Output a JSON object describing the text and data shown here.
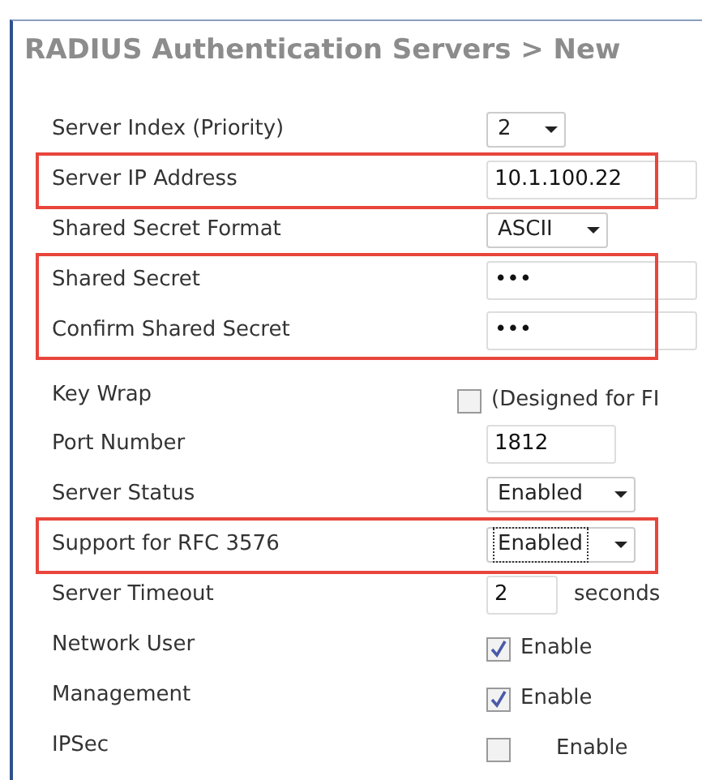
{
  "title": "RADIUS Authentication Servers > New",
  "sections": [
    {
      "highlighted": false,
      "rows": [
        {
          "label": "Server Index (Priority)",
          "kind": "select",
          "value": "2",
          "focused": false
        }
      ]
    },
    {
      "highlighted": true,
      "rows": [
        {
          "label": "Server IP Address",
          "kind": "text",
          "value": "10.1.100.22"
        }
      ]
    },
    {
      "highlighted": false,
      "rows": [
        {
          "label": "Shared Secret Format",
          "kind": "select",
          "value": "ASCII",
          "focused": false
        }
      ]
    },
    {
      "highlighted": true,
      "rows": [
        {
          "label": "Shared Secret",
          "kind": "text",
          "value": "•••"
        },
        {
          "label": "Confirm Shared Secret",
          "kind": "text",
          "value": "•••"
        }
      ]
    },
    {
      "highlighted": false,
      "rows": [
        {
          "label": "Key Wrap",
          "kind": "checkbox",
          "checked": false,
          "text": "(Designed for FI"
        },
        {
          "label": "Port Number",
          "kind": "text",
          "value": "1812"
        },
        {
          "label": "Server Status",
          "kind": "select",
          "value": "Enabled",
          "focused": false
        }
      ]
    },
    {
      "highlighted": true,
      "rows": [
        {
          "label": "Support for RFC 3576",
          "kind": "select",
          "value": "Enabled",
          "focused": true
        }
      ]
    },
    {
      "highlighted": false,
      "rows": [
        {
          "label": "Server Timeout",
          "kind": "text",
          "value": "2",
          "suffix": "seconds"
        },
        {
          "label": "Network User",
          "kind": "checkbox",
          "checked": true,
          "text": "Enable"
        },
        {
          "label": "Management",
          "kind": "checkbox",
          "checked": true,
          "text": "Enable"
        },
        {
          "label": "IPSec",
          "kind": "checkbox",
          "checked": false,
          "text": "Enable"
        }
      ]
    }
  ]
}
